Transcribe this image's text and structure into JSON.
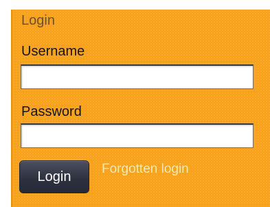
{
  "login_box": {
    "title": "Login",
    "username_label": "Username",
    "username_value": "",
    "password_label": "Password",
    "password_value": "",
    "submit_label": "Login",
    "forgot_link": "Forgotten login"
  },
  "colors": {
    "panel_background": "#f7a21b",
    "button_background": "#2e3241",
    "link_text": "#fde9b0"
  }
}
